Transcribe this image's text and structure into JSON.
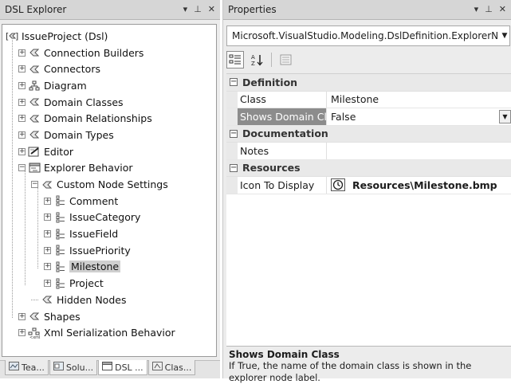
{
  "explorer": {
    "title": "DSL Explorer",
    "pin_glyph": "−\t",
    "tree": [
      {
        "label": "IssueProject (Dsl)",
        "icon": "dsl-root-icon",
        "depth": 0,
        "expander": "none"
      },
      {
        "label": "Connection Builders",
        "icon": "element-icon",
        "depth": 1,
        "expander": "+"
      },
      {
        "label": "Connectors",
        "icon": "element-icon",
        "depth": 1,
        "expander": "+"
      },
      {
        "label": "Diagram",
        "icon": "diagram-icon",
        "depth": 1,
        "expander": "+"
      },
      {
        "label": "Domain Classes",
        "icon": "element-icon",
        "depth": 1,
        "expander": "+"
      },
      {
        "label": "Domain Relationships",
        "icon": "element-icon",
        "depth": 1,
        "expander": "+"
      },
      {
        "label": "Domain Types",
        "icon": "element-icon",
        "depth": 1,
        "expander": "+"
      },
      {
        "label": "Editor",
        "icon": "editor-icon",
        "depth": 1,
        "expander": "+"
      },
      {
        "label": "Explorer Behavior",
        "icon": "explorer-icon",
        "depth": 1,
        "expander": "-"
      },
      {
        "label": "Custom Node Settings",
        "icon": "element-icon",
        "depth": 2,
        "expander": "-"
      },
      {
        "label": "Comment",
        "icon": "node-settings-icon",
        "depth": 3,
        "expander": "+"
      },
      {
        "label": "IssueCategory",
        "icon": "node-settings-icon",
        "depth": 3,
        "expander": "+"
      },
      {
        "label": "IssueField",
        "icon": "node-settings-icon",
        "depth": 3,
        "expander": "+"
      },
      {
        "label": "IssuePriority",
        "icon": "node-settings-icon",
        "depth": 3,
        "expander": "+"
      },
      {
        "label": "Milestone",
        "icon": "node-settings-icon",
        "depth": 3,
        "expander": "+",
        "selected": true
      },
      {
        "label": "Project",
        "icon": "node-settings-icon",
        "depth": 3,
        "expander": "+"
      },
      {
        "label": "Hidden Nodes",
        "icon": "element-icon",
        "depth": 2,
        "expander": "none"
      },
      {
        "label": "Shapes",
        "icon": "element-icon",
        "depth": 1,
        "expander": "+"
      },
      {
        "label": "Xml Serialization Behavior",
        "icon": "xml-icon",
        "depth": 1,
        "expander": "+"
      }
    ],
    "tabs": [
      {
        "label": "Tea...",
        "icon": "team-explorer-icon"
      },
      {
        "label": "Solu...",
        "icon": "solution-explorer-icon"
      },
      {
        "label": "DSL ...",
        "icon": "dsl-explorer-icon",
        "active": true
      },
      {
        "label": "Clas...",
        "icon": "class-view-icon"
      }
    ]
  },
  "properties": {
    "title": "Properties",
    "selected_object": "Microsoft.VisualStudio.Modeling.DslDefinition.ExplorerN",
    "categories": [
      {
        "name": "Definition",
        "rows": [
          {
            "name": "Class",
            "value": "Milestone"
          },
          {
            "name": "Shows Domain Cl",
            "value": "False",
            "selected": true,
            "dropdown": true
          }
        ]
      },
      {
        "name": "Documentation",
        "rows": [
          {
            "name": "Notes",
            "value": ""
          }
        ]
      },
      {
        "name": "Resources",
        "rows": [
          {
            "name": "Icon To Display",
            "value": "Resources\\Milestone.bmp",
            "bold": true,
            "icon": "clock-icon"
          }
        ]
      }
    ],
    "description": {
      "title": "Shows Domain Class",
      "text": "If True, the name of the domain class is shown in the explorer node label."
    }
  }
}
